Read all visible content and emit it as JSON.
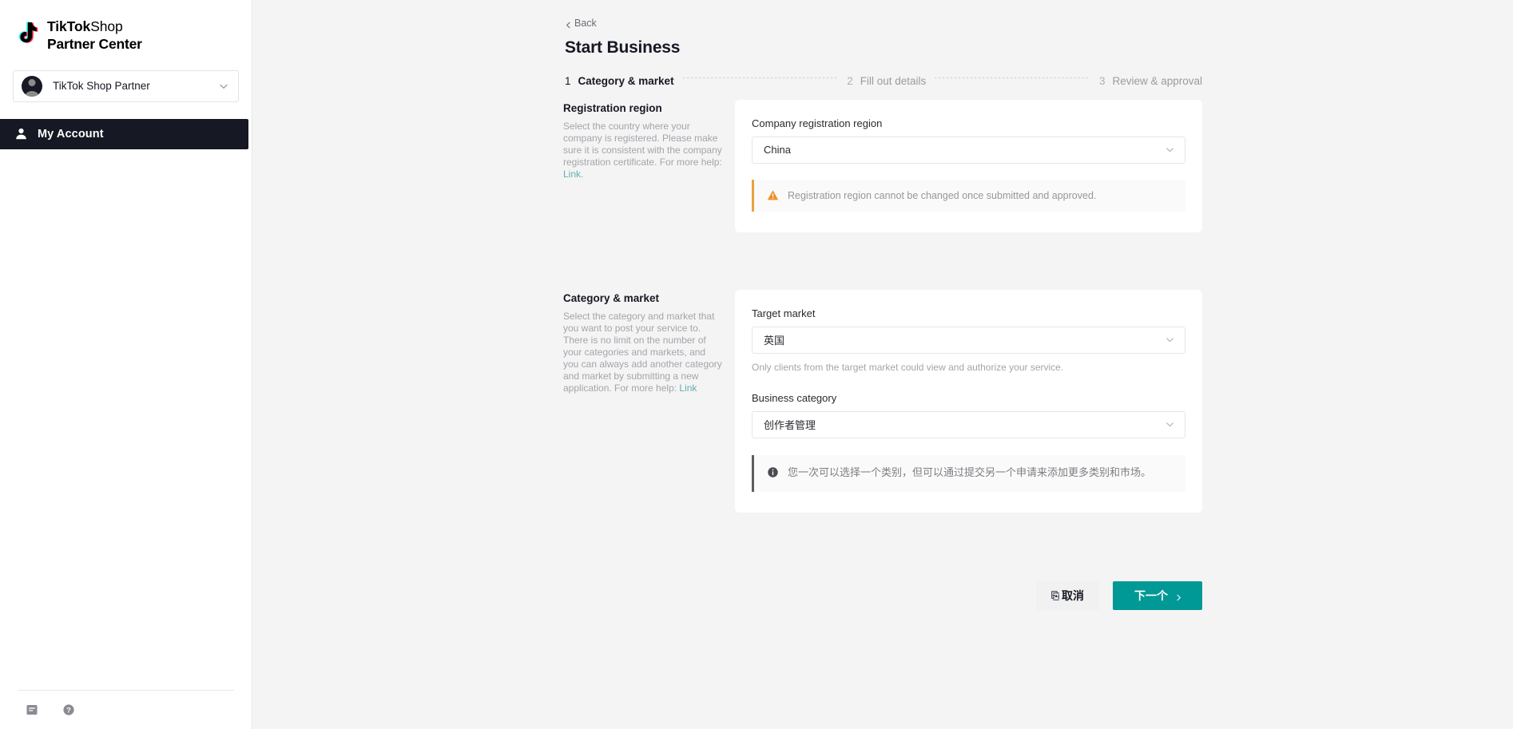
{
  "sidebar": {
    "brand": {
      "line1_bold": "TikTok",
      "line1_light": "Shop",
      "line2": "Partner Center",
      "logo_icon": "tiktok-note-icon"
    },
    "account": {
      "name": "TikTok Shop Partner",
      "avatar_icon": "user-avatar-icon",
      "chevron_icon": "chevron-down-icon"
    },
    "nav": [
      {
        "label": "My Account",
        "icon": "person-icon",
        "active": true
      }
    ],
    "footer_icons": [
      {
        "name": "document-icon"
      },
      {
        "name": "help-circle-icon"
      }
    ]
  },
  "header": {
    "back_label": "Back",
    "back_icon": "chevron-left-icon",
    "title": "Start Business"
  },
  "stepper": {
    "steps": [
      {
        "num": "1",
        "label": "Category & market",
        "active": true
      },
      {
        "num": "2",
        "label": "Fill out details",
        "active": false
      },
      {
        "num": "3",
        "label": "Review & approval",
        "active": false
      }
    ]
  },
  "registration_section": {
    "title": "Registration region",
    "description": "Select the country where your company is registered. Please make sure it is consistent with the company registration certificate. For more help: ",
    "link_label": "Link",
    "description_tail": ".",
    "field_label": "Company registration region",
    "field_value": "China",
    "chevron_icon": "chevron-down-icon",
    "warning": {
      "icon": "warning-triangle-icon",
      "text": "Registration region cannot be changed once submitted and approved.",
      "accent_color": "#e8a33d"
    }
  },
  "category_section": {
    "title": "Category & market",
    "description": "Select the category and market that you want to post your service to. There is no limit on the number of your categories and markets, and you can always add another category and market by submitting a new application. For more help: ",
    "link_label": "Link",
    "target_market_label": "Target market",
    "target_market_value": "英国",
    "target_market_hint": "Only clients from the target market could view and authorize your service.",
    "business_category_label": "Business category",
    "business_category_value": "创作者管理",
    "chevron_icon": "chevron-down-icon",
    "info": {
      "icon": "info-circle-icon",
      "text": "您一次可以选择一个类别，但可以通过提交另一个申请来添加更多类别和市场。",
      "accent_color": "#5c5d61"
    }
  },
  "actions": {
    "cancel_label": "取消",
    "cancel_glyph": "⎘",
    "next_label": "下一个",
    "next_icon": "chevron-right-icon",
    "next_color": "#009995"
  }
}
